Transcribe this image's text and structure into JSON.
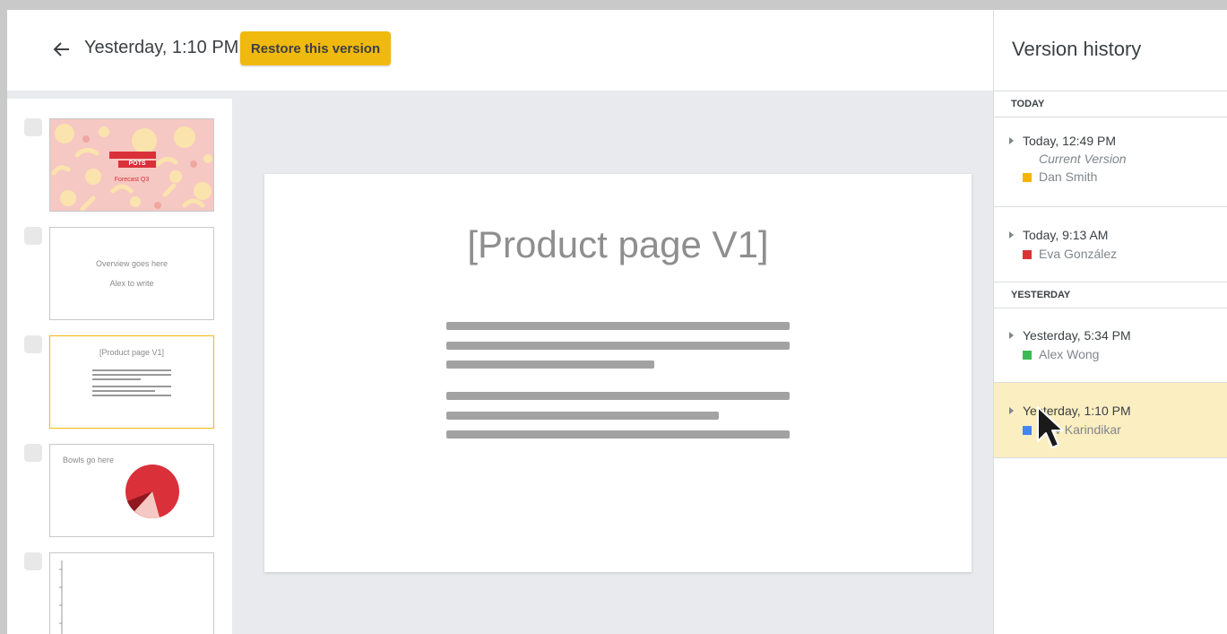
{
  "header": {
    "version_title": "Yesterday, 1:10 PM",
    "restore_label": "Restore this version"
  },
  "filmstrip": {
    "slides": [
      {
        "brand_line1": "PECULIAR",
        "brand_line2": "POTS",
        "subtitle": "Forecast Q3"
      },
      {
        "line1": "Overview goes here",
        "line2": "Alex to write"
      },
      {
        "title": "[Product page V1]"
      },
      {
        "title": "Bowls go here"
      },
      {}
    ]
  },
  "main_slide": {
    "heading": "[Product page V1]"
  },
  "version_history": {
    "title": "Version history",
    "sections": [
      {
        "label": "TODAY",
        "entries": [
          {
            "time": "Today, 12:49 PM",
            "note": "Current Version",
            "author": "Dan Smith",
            "color": "#f4b400"
          },
          {
            "time": "Today, 9:13 AM",
            "author": "Eva González",
            "color": "#db3236"
          }
        ]
      },
      {
        "label": "YESTERDAY",
        "entries": [
          {
            "time": "Yesterday, 5:34 PM",
            "author": "Alex Wong",
            "color": "#3cba54"
          },
          {
            "time": "Yesterday, 1:10 PM",
            "author": "Dev Karindikar",
            "color": "#4285f4"
          }
        ]
      }
    ]
  },
  "colors": {
    "accent": "#f0b90e",
    "selected_highlight": "#fbeec1",
    "pattern_bg": "#f6c8c3",
    "brand_red": "#d9303a"
  }
}
